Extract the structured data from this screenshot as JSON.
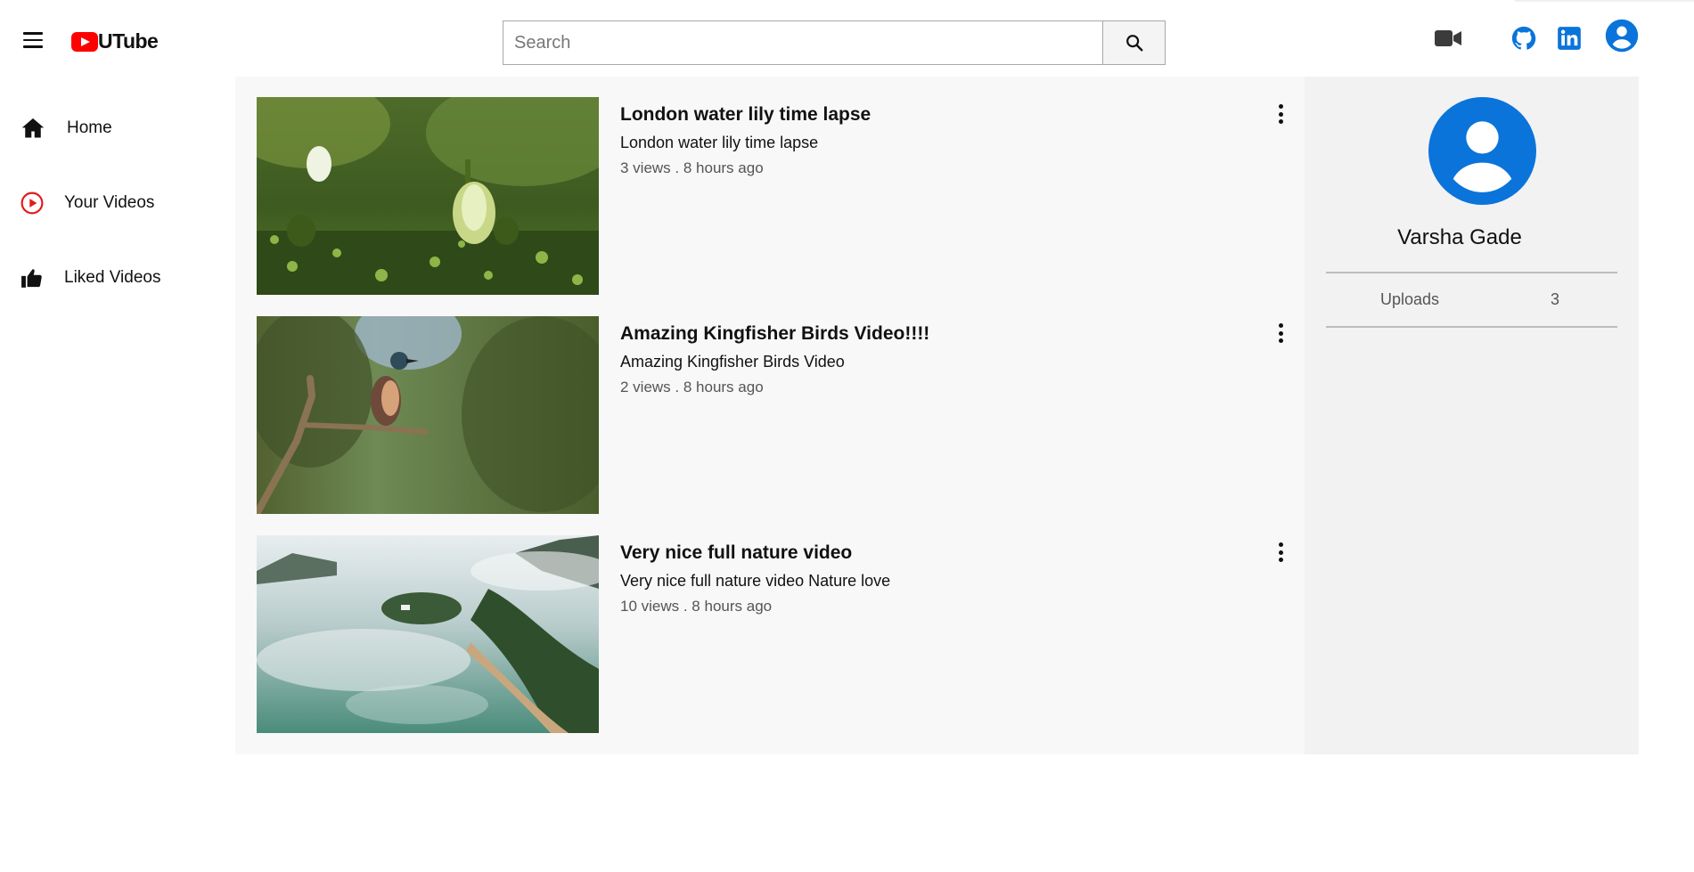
{
  "app": {
    "logo_text": "UTube",
    "brand_color": "#ff0000",
    "accent_color": "#0a74da"
  },
  "header": {
    "menu_icon": "hamburger-menu-icon",
    "search": {
      "placeholder": "Search",
      "value": "",
      "button_icon": "search-icon"
    },
    "icons": [
      "video-camera-icon",
      "github-icon",
      "linkedin-icon",
      "account-circle-icon"
    ]
  },
  "sidebar": {
    "items": [
      {
        "label": "Home",
        "icon": "home-icon"
      },
      {
        "label": "Your Videos",
        "icon": "play-circle-icon"
      },
      {
        "label": "Liked Videos",
        "icon": "thumbs-up-icon"
      }
    ]
  },
  "videos": [
    {
      "title": "London water lily time lapse",
      "description": "London water lily time lapse",
      "meta": "3 views . 8 hours ago"
    },
    {
      "title": "Amazing Kingfisher Birds Video!!!!",
      "description": "Amazing Kingfisher Birds Video",
      "meta": "2 views . 8 hours ago"
    },
    {
      "title": "Very nice full nature video",
      "description": "Very nice full nature video Nature love",
      "meta": "10 views . 8 hours ago"
    }
  ],
  "profile": {
    "name": "Varsha Gade",
    "uploads_label": "Uploads",
    "uploads_count": "3"
  }
}
